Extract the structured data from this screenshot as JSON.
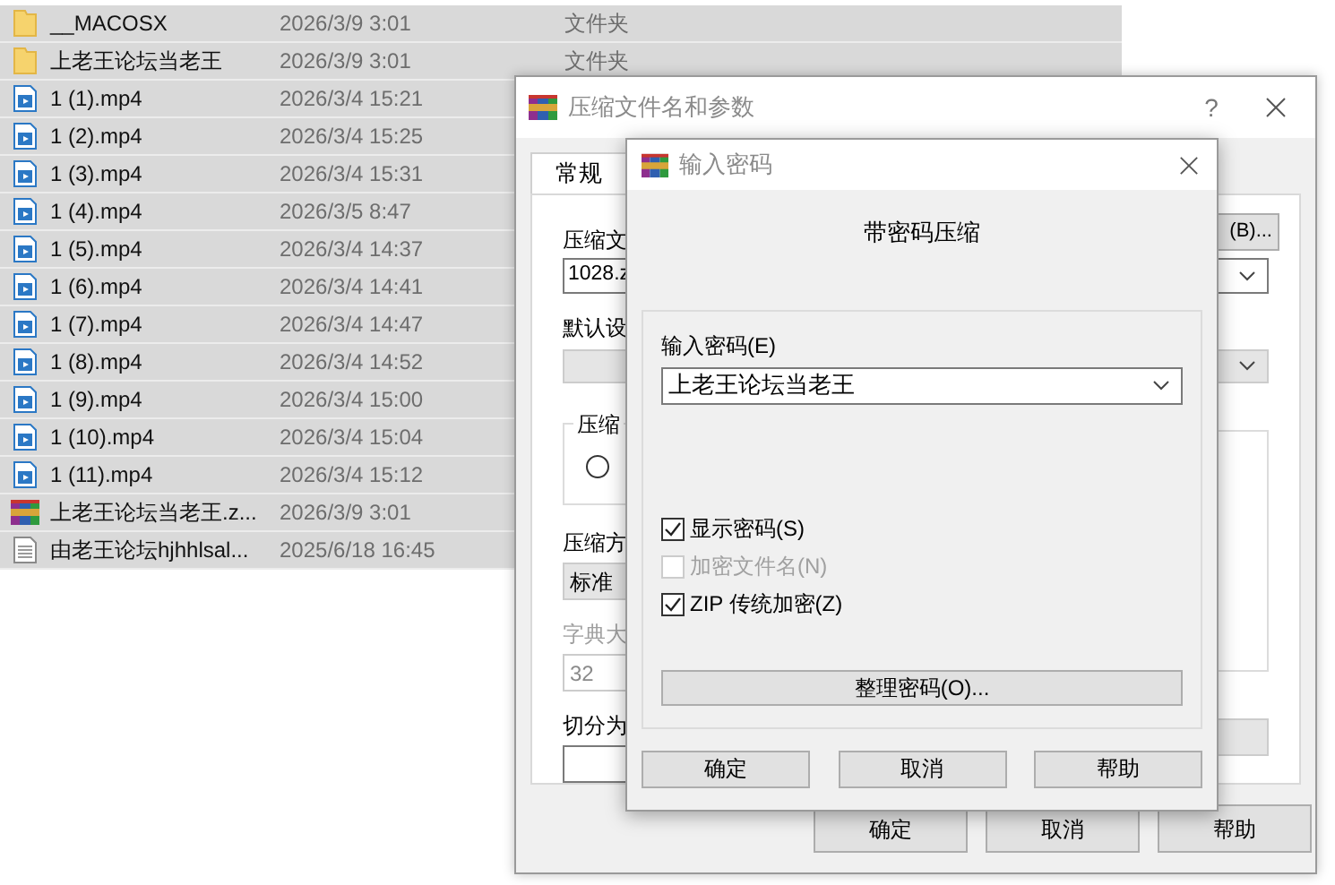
{
  "file_list": {
    "rows": [
      {
        "kind": "folder",
        "name": "__MACOSX",
        "date": "2026/3/9 3:01",
        "type": "文件夹"
      },
      {
        "kind": "folder",
        "name": "上老王论坛当老王",
        "date": "2026/3/9 3:01",
        "type": "文件夹"
      },
      {
        "kind": "video",
        "name": "1 (1).mp4",
        "date": "2026/3/4 15:21"
      },
      {
        "kind": "video",
        "name": "1 (2).mp4",
        "date": "2026/3/4 15:25"
      },
      {
        "kind": "video",
        "name": "1 (3).mp4",
        "date": "2026/3/4 15:31"
      },
      {
        "kind": "video",
        "name": "1 (4).mp4",
        "date": "2026/3/5 8:47"
      },
      {
        "kind": "video",
        "name": "1 (5).mp4",
        "date": "2026/3/4 14:37"
      },
      {
        "kind": "video",
        "name": "1 (6).mp4",
        "date": "2026/3/4 14:41"
      },
      {
        "kind": "video",
        "name": "1 (7).mp4",
        "date": "2026/3/4 14:47"
      },
      {
        "kind": "video",
        "name": "1 (8).mp4",
        "date": "2026/3/4 14:52"
      },
      {
        "kind": "video",
        "name": "1 (9).mp4",
        "date": "2026/3/4 15:00"
      },
      {
        "kind": "video",
        "name": "1 (10).mp4",
        "date": "2026/3/4 15:04"
      },
      {
        "kind": "video",
        "name": "1 (11).mp4",
        "date": "2026/3/4 15:12"
      },
      {
        "kind": "archive",
        "name": "上老王论坛当老王.z...",
        "date": "2026/3/9 3:01"
      },
      {
        "kind": "text",
        "name": "由老王论坛hjhhlsal...",
        "date": "2025/6/18 16:45"
      }
    ]
  },
  "archive_dialog": {
    "title": "压缩文件名和参数",
    "help": "?",
    "tabs": [
      {
        "label": "常规",
        "selected": true
      }
    ],
    "archive_name_label": "压缩文",
    "browse_button": "(B)...",
    "archive_name": "1028.z",
    "profile_label": "默认设",
    "format_group_label": "压缩",
    "format_options": [
      {
        "selected": false
      }
    ],
    "method_label": "压缩方",
    "method": "标准",
    "dictionary": {
      "label": "字典大",
      "value": "32",
      "disabled": true
    },
    "split_label": "切分为",
    "buttons": [
      "确定",
      "取消",
      "帮助"
    ]
  },
  "password_dialog": {
    "title": "输入密码",
    "heading": "带密码压缩",
    "password_label": "输入密码(E)",
    "password": "上老王论坛当老王",
    "options": [
      {
        "label": "显示密码(S)",
        "checked": true,
        "disabled": false
      },
      {
        "label": "加密文件名(N)",
        "checked": false,
        "disabled": true
      },
      {
        "label": "ZIP 传统加密(Z)",
        "checked": true,
        "disabled": false
      }
    ],
    "organize_button": "整理密码(O)...",
    "buttons": [
      "确定",
      "取消",
      "帮助"
    ]
  }
}
